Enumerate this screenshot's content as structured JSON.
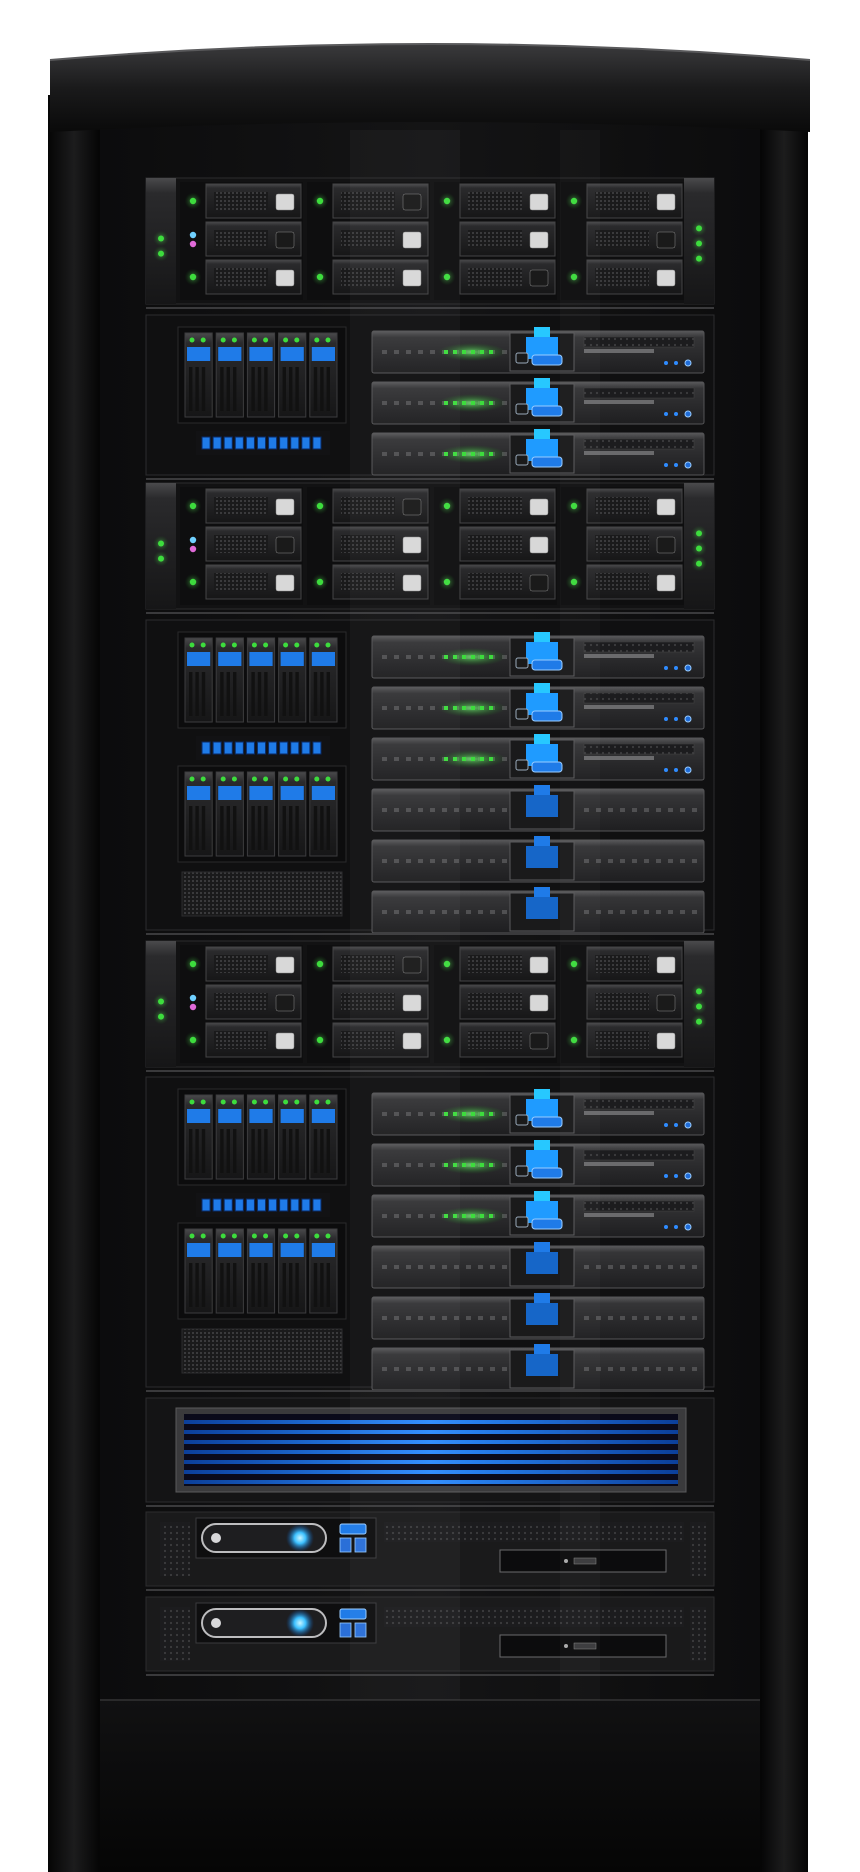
{
  "rack": {
    "sections": [
      {
        "type": "drive-bay-chassis"
      },
      {
        "type": "blade-enclosure",
        "blade_servers": 3,
        "plain_units": 0,
        "drive_cages": 1,
        "port_strips": 1,
        "vent_grilles": 0
      },
      {
        "type": "drive-bay-chassis"
      },
      {
        "type": "blade-enclosure",
        "blade_servers": 3,
        "plain_units": 3,
        "drive_cages": 2,
        "port_strips": 1,
        "vent_grilles": 1
      },
      {
        "type": "drive-bay-chassis"
      },
      {
        "type": "blade-enclosure",
        "blade_servers": 3,
        "plain_units": 3,
        "drive_cages": 2,
        "port_strips": 1,
        "vent_grilles": 1
      },
      {
        "type": "display-unit"
      },
      {
        "type": "power-unit"
      },
      {
        "type": "power-unit"
      }
    ]
  },
  "colors": {
    "frame": "#0b0b0c",
    "panel": "#1c1c1e",
    "accent_blue": "#1f7be8",
    "led_green": "#3ddc3d",
    "led_blue": "#6fd0ff",
    "led_pink": "#e06ad8"
  }
}
